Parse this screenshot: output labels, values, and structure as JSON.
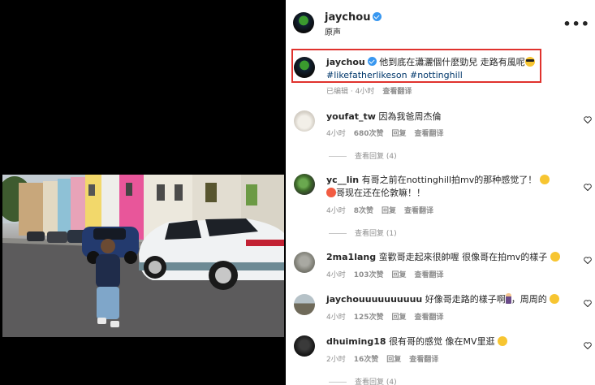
{
  "post": {
    "username": "jaychou",
    "audio_label": "原声",
    "more_label": "•••"
  },
  "caption": {
    "username": "jaychou",
    "text": "他到底在瀟灑個什麼勁兒 走路有風呢",
    "hashtags": "#likefatherlikeson #nottinghill",
    "edited": "已编辑 · 4小时",
    "translate": "查看翻译"
  },
  "comments": [
    {
      "username": "youfat_tw",
      "text": "因為我爸周杰倫",
      "time": "4小时",
      "likes": "680次赞",
      "reply": "回复",
      "translate": "查看翻译",
      "view_replies": "查看回复 (4)"
    },
    {
      "username": "yc__lin",
      "text": "有哥之前在nottinghill拍mv的那种感觉了！",
      "text_tail": "哥现在还在伦敦嘛！！",
      "time": "4小时",
      "likes": "8次赞",
      "reply": "回复",
      "translate": "查看翻译",
      "view_replies": "查看回复 (1)"
    },
    {
      "username": "2ma1lang",
      "text": "蛮歡哥走起來很帥喔 很像哥在拍mv的樣子",
      "time": "4小时",
      "likes": "103次赞",
      "reply": "回复",
      "translate": "查看翻译"
    },
    {
      "username": "jaychouuuuuuuuuu",
      "text": "好像哥走路的樣子啊",
      "text_tail": "，周周的",
      "time": "4小时",
      "likes": "125次赞",
      "reply": "回复",
      "translate": "查看翻译"
    },
    {
      "username": "dhuiming18",
      "text": "很有哥的感觉 像在MV里逛",
      "time": "2小时",
      "likes": "16次赞",
      "reply": "回复",
      "translate": "查看翻译",
      "view_replies": "查看回复 (4)"
    }
  ],
  "colors": {
    "highlight_border": "#e0322d",
    "verified": "#3897f0",
    "hashtag": "#00376b",
    "meta_text": "#8e8e8e"
  }
}
